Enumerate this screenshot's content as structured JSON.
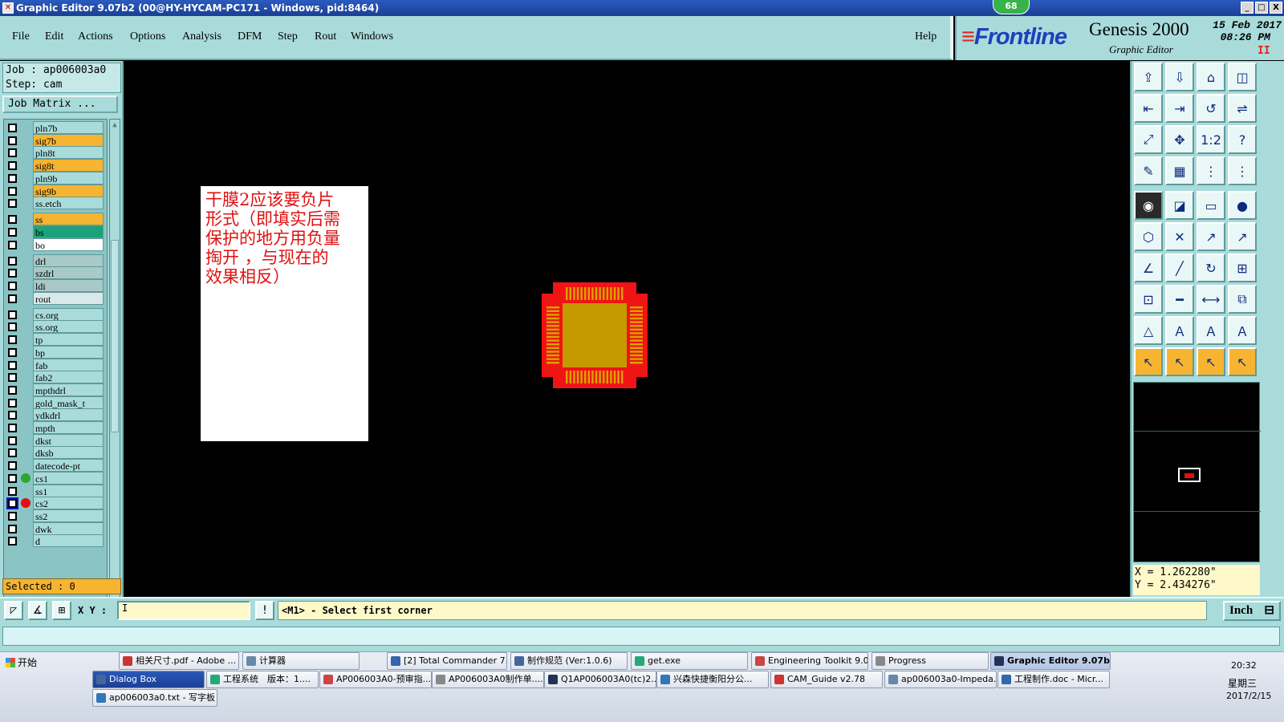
{
  "window": {
    "title": "Graphic Editor 9.07b2 (00@HY-HYCAM-PC171 - Windows, pid:8464)",
    "badge": "68",
    "buttons": [
      "_",
      "□",
      "X"
    ]
  },
  "menu": {
    "items": [
      "File",
      "Edit",
      "Actions",
      "Options",
      "Analysis",
      "DFM",
      "Step",
      "Rout",
      "Windows"
    ],
    "help": "Help"
  },
  "brand": {
    "logo_stripes": "≡",
    "logo": "Frontline",
    "product": "Genesis 2000",
    "subtitle": "Graphic Editor",
    "date": "15 Feb 2017",
    "time": "08:26 PM",
    "pause": "II"
  },
  "job": {
    "job_line": "Job : ap006003a0",
    "step_line": "Step: cam",
    "matrix_button": "Job Matrix ..."
  },
  "layers": [
    {
      "name": "pln7b",
      "color": "#a9dbdb",
      "dot": ""
    },
    {
      "name": "sig7b",
      "color": "#f7b430",
      "dot": ""
    },
    {
      "name": "pln8t",
      "color": "#a9dbdb",
      "dot": ""
    },
    {
      "name": "sig8t",
      "color": "#f7b430",
      "dot": ""
    },
    {
      "name": "pln9b",
      "color": "#a9dbdb",
      "dot": ""
    },
    {
      "name": "sig9b",
      "color": "#f7b430",
      "dot": ""
    },
    {
      "name": "ss.etch",
      "color": "#a9dbdb",
      "dot": ""
    },
    {
      "name": "ss",
      "color": "#f7b430",
      "dot": ""
    },
    {
      "name": "bs",
      "color": "#1aa37a",
      "dot": ""
    },
    {
      "name": "bo",
      "color": "#ffffff",
      "dot": ""
    },
    {
      "name": "drl",
      "color": "#a9c8c8",
      "dot": ""
    },
    {
      "name": "szdrl",
      "color": "#a9c8c8",
      "dot": ""
    },
    {
      "name": "ldi",
      "color": "#a9c8c8",
      "dot": ""
    },
    {
      "name": "rout",
      "color": "#d9e9e9",
      "dot": ""
    },
    {
      "name": "cs.org",
      "color": "#a9dbdb",
      "dot": ""
    },
    {
      "name": "ss.org",
      "color": "#a9dbdb",
      "dot": ""
    },
    {
      "name": "tp",
      "color": "#a9dbdb",
      "dot": ""
    },
    {
      "name": "bp",
      "color": "#a9dbdb",
      "dot": ""
    },
    {
      "name": "fab",
      "color": "#a9dbdb",
      "dot": ""
    },
    {
      "name": "fab2",
      "color": "#a9dbdb",
      "dot": ""
    },
    {
      "name": "mpthdrl",
      "color": "#a9dbdb",
      "dot": ""
    },
    {
      "name": "gold_mask_t",
      "color": "#a9dbdb",
      "dot": ""
    },
    {
      "name": "ydkdrl",
      "color": "#a9dbdb",
      "dot": ""
    },
    {
      "name": "mpth",
      "color": "#a9dbdb",
      "dot": ""
    },
    {
      "name": "dkst",
      "color": "#a9dbdb",
      "dot": ""
    },
    {
      "name": "dksb",
      "color": "#a9dbdb",
      "dot": ""
    },
    {
      "name": "datecode-pt",
      "color": "#a9dbdb",
      "dot": ""
    },
    {
      "name": "cs1",
      "color": "#a9dbdb",
      "dot": "#2fa62f"
    },
    {
      "name": "ss1",
      "color": "#a9dbdb",
      "dot": ""
    },
    {
      "name": "cs2",
      "color": "#a9dbdb",
      "dot": "#e01010"
    },
    {
      "name": "ss2",
      "color": "#a9dbdb",
      "dot": ""
    },
    {
      "name": "dwk",
      "color": "#a9dbdb",
      "dot": ""
    },
    {
      "name": "d",
      "color": "#a9dbdb",
      "dot": ""
    }
  ],
  "selected": "Selected : 0",
  "note": {
    "lines": [
      "干膜2应该要负片",
      "形式（即填实后需",
      "保护的地方用负量",
      "掏开 ，与现在的",
      "效果相反）"
    ]
  },
  "tools": [
    "⇪",
    "⇩",
    "⌂",
    "◫",
    "⇤",
    "⇥",
    "↺",
    "⇌",
    "⤢",
    "✥",
    "1:2",
    "?",
    "✎",
    "▦",
    "⋮",
    "⋮",
    "◉",
    "◪",
    "▭",
    "●",
    "⬡",
    "✕",
    "↗",
    "↗",
    "∠",
    "╱",
    "↻",
    "⊞",
    "⊡",
    "━",
    "⟷",
    "⧉",
    "△",
    "Ａ",
    "Ａ",
    "Ａ",
    "↖",
    "↖",
    "↖",
    "↖"
  ],
  "coords": {
    "x": "X = 1.262280\"",
    "y": "Y = 2.434276\""
  },
  "command": {
    "xy_label": "X Y :",
    "xy_value": "I",
    "info": "!",
    "message": "<M1> - Select first corner",
    "units": "Inch",
    "units_icon": "⊟"
  },
  "taskbar": {
    "start": "开始",
    "row1": [
      "相关尺寸.pdf - Adobe ...",
      "计算器",
      "[2] Total Commander 7....",
      "制作规范 (Ver:1.0.6)",
      "get.exe",
      "Engineering Toolkit 9.0...",
      "Progress",
      "Graphic Editor 9.07b..."
    ],
    "row2": [
      "Dialog Box",
      "工程系统　版本：1....",
      "AP006003A0-预审指...",
      "AP006003A0制作单....",
      "Q1AP006003A0(tc)2...",
      "兴森快捷衡阳分公...",
      "CAM_Guide v2.78",
      "ap006003a0-Impeda...",
      "工程制作.doc - Micr..."
    ],
    "row3": [
      "ap006003a0.txt - 写字板"
    ],
    "tray_time": "20:32",
    "tray_day": "星期三",
    "tray_date": "2017/2/15"
  }
}
